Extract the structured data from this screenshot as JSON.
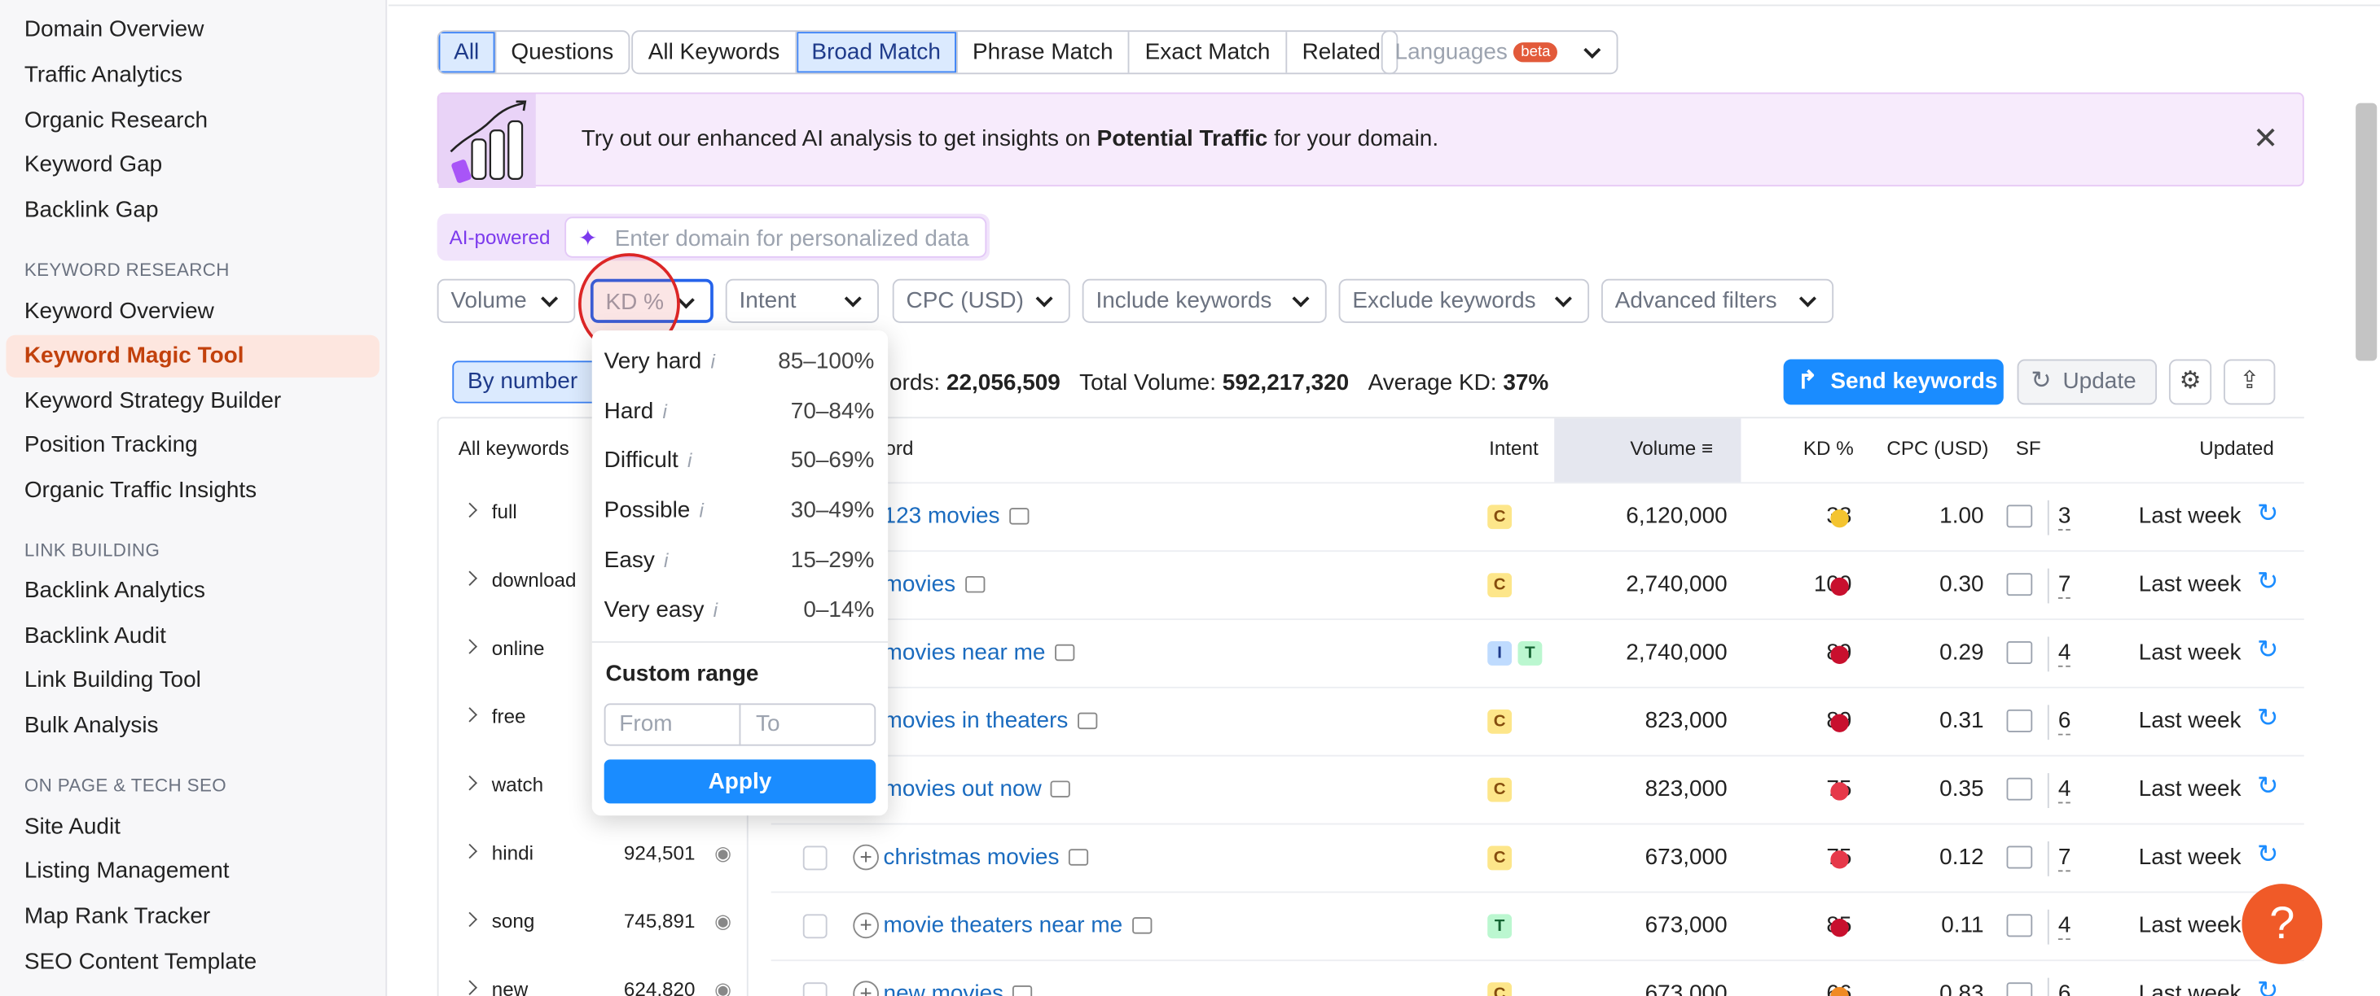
{
  "sidebar": {
    "top_items": [
      "Domain Overview",
      "Traffic Analytics",
      "Organic Research",
      "Keyword Gap",
      "Backlink Gap"
    ],
    "keyword_research": {
      "title": "KEYWORD RESEARCH",
      "items": [
        "Keyword Overview",
        "Keyword Magic Tool",
        "Keyword Strategy Builder",
        "Position Tracking",
        "Organic Traffic Insights"
      ],
      "active": "Keyword Magic Tool"
    },
    "link_building": {
      "title": "LINK BUILDING",
      "items": [
        "Backlink Analytics",
        "Backlink Audit",
        "Link Building Tool",
        "Bulk Analysis"
      ]
    },
    "on_page": {
      "title": "ON PAGE & TECH SEO",
      "items": [
        "Site Audit",
        "Listing Management",
        "Map Rank Tracker",
        "SEO Content Template"
      ]
    }
  },
  "tabs": {
    "type": [
      "All",
      "Questions"
    ],
    "match": [
      "All Keywords",
      "Broad Match",
      "Phrase Match",
      "Exact Match",
      "Related"
    ],
    "languages": "Languages",
    "beta": "beta"
  },
  "banner": {
    "pre": "Try out our enhanced AI analysis to get insights on ",
    "bold": "Potential Traffic",
    "post": " for your domain.",
    "close": "✕"
  },
  "ai": {
    "label": "AI-powered",
    "placeholder": "Enter domain for personalized data"
  },
  "filters": [
    "Volume",
    "KD %",
    "Intent",
    "CPC (USD)",
    "Include keywords",
    "Exclude keywords",
    "Advanced filters"
  ],
  "kd_dropdown": {
    "options": [
      {
        "name": "Very hard",
        "range": "85–100%"
      },
      {
        "name": "Hard",
        "range": "70–84%"
      },
      {
        "name": "Difficult",
        "range": "50–69%"
      },
      {
        "name": "Possible",
        "range": "30–49%"
      },
      {
        "name": "Easy",
        "range": "15–29%"
      },
      {
        "name": "Very easy",
        "range": "0–14%"
      }
    ],
    "info": "i",
    "custom_range": "Custom range",
    "from": "From",
    "to": "To",
    "apply": "Apply"
  },
  "stats": {
    "by_number": "By number",
    "kw_label": "ords:",
    "kw_value": "22,056,509",
    "vol_label": "Total Volume:",
    "vol_value": "592,217,320",
    "kd_label": "Average KD:",
    "kd_value": "37%"
  },
  "actions": {
    "send": "Send keywords",
    "update": "Update"
  },
  "groups": {
    "header": "All keywords",
    "items": [
      {
        "name": "full",
        "count": ""
      },
      {
        "name": "download",
        "count": ""
      },
      {
        "name": "online",
        "count": ""
      },
      {
        "name": "free",
        "count": ""
      },
      {
        "name": "watch",
        "count": ""
      },
      {
        "name": "hindi",
        "count": "924,501"
      },
      {
        "name": "song",
        "count": "745,891"
      },
      {
        "name": "new",
        "count": "624,820"
      }
    ]
  },
  "table": {
    "headers": {
      "keyword": "ord",
      "intent": "Intent",
      "volume": "Volume",
      "kd": "KD %",
      "cpc": "CPC (USD)",
      "sf": "SF",
      "updated": "Updated"
    },
    "rows": [
      {
        "keyword": "123 movies",
        "intent": [
          "C"
        ],
        "volume": "6,120,000",
        "kd": "33",
        "kd_color": "#f4c430",
        "cpc": "1.00",
        "sf": "3",
        "updated": "Last week"
      },
      {
        "keyword": "movies",
        "intent": [
          "C"
        ],
        "volume": "2,740,000",
        "kd": "100",
        "kd_color": "#c8102e",
        "cpc": "0.30",
        "sf": "7",
        "updated": "Last week"
      },
      {
        "keyword": "movies near me",
        "intent": [
          "I",
          "T"
        ],
        "volume": "2,740,000",
        "kd": "89",
        "kd_color": "#c8102e",
        "cpc": "0.29",
        "sf": "4",
        "updated": "Last week"
      },
      {
        "keyword": "movies in theaters",
        "intent": [
          "C"
        ],
        "volume": "823,000",
        "kd": "89",
        "kd_color": "#c8102e",
        "cpc": "0.31",
        "sf": "6",
        "updated": "Last week"
      },
      {
        "keyword": "movies out now",
        "intent": [
          "C"
        ],
        "volume": "823,000",
        "kd": "75",
        "kd_color": "#e6394a",
        "cpc": "0.35",
        "sf": "4",
        "updated": "Last week"
      },
      {
        "keyword": "christmas movies",
        "intent": [
          "C"
        ],
        "volume": "673,000",
        "kd": "75",
        "kd_color": "#e6394a",
        "cpc": "0.12",
        "sf": "7",
        "updated": "Last week"
      },
      {
        "keyword": "movie theaters near me",
        "intent": [
          "T"
        ],
        "volume": "673,000",
        "kd": "85",
        "kd_color": "#c8102e",
        "cpc": "0.11",
        "sf": "4",
        "updated": "Last week"
      },
      {
        "keyword": "new movies",
        "intent": [
          "C"
        ],
        "volume": "673,000",
        "kd": "66",
        "kd_color": "#f08a24",
        "cpc": "0.83",
        "sf": "6",
        "updated": "Last week"
      }
    ]
  },
  "help": "?"
}
